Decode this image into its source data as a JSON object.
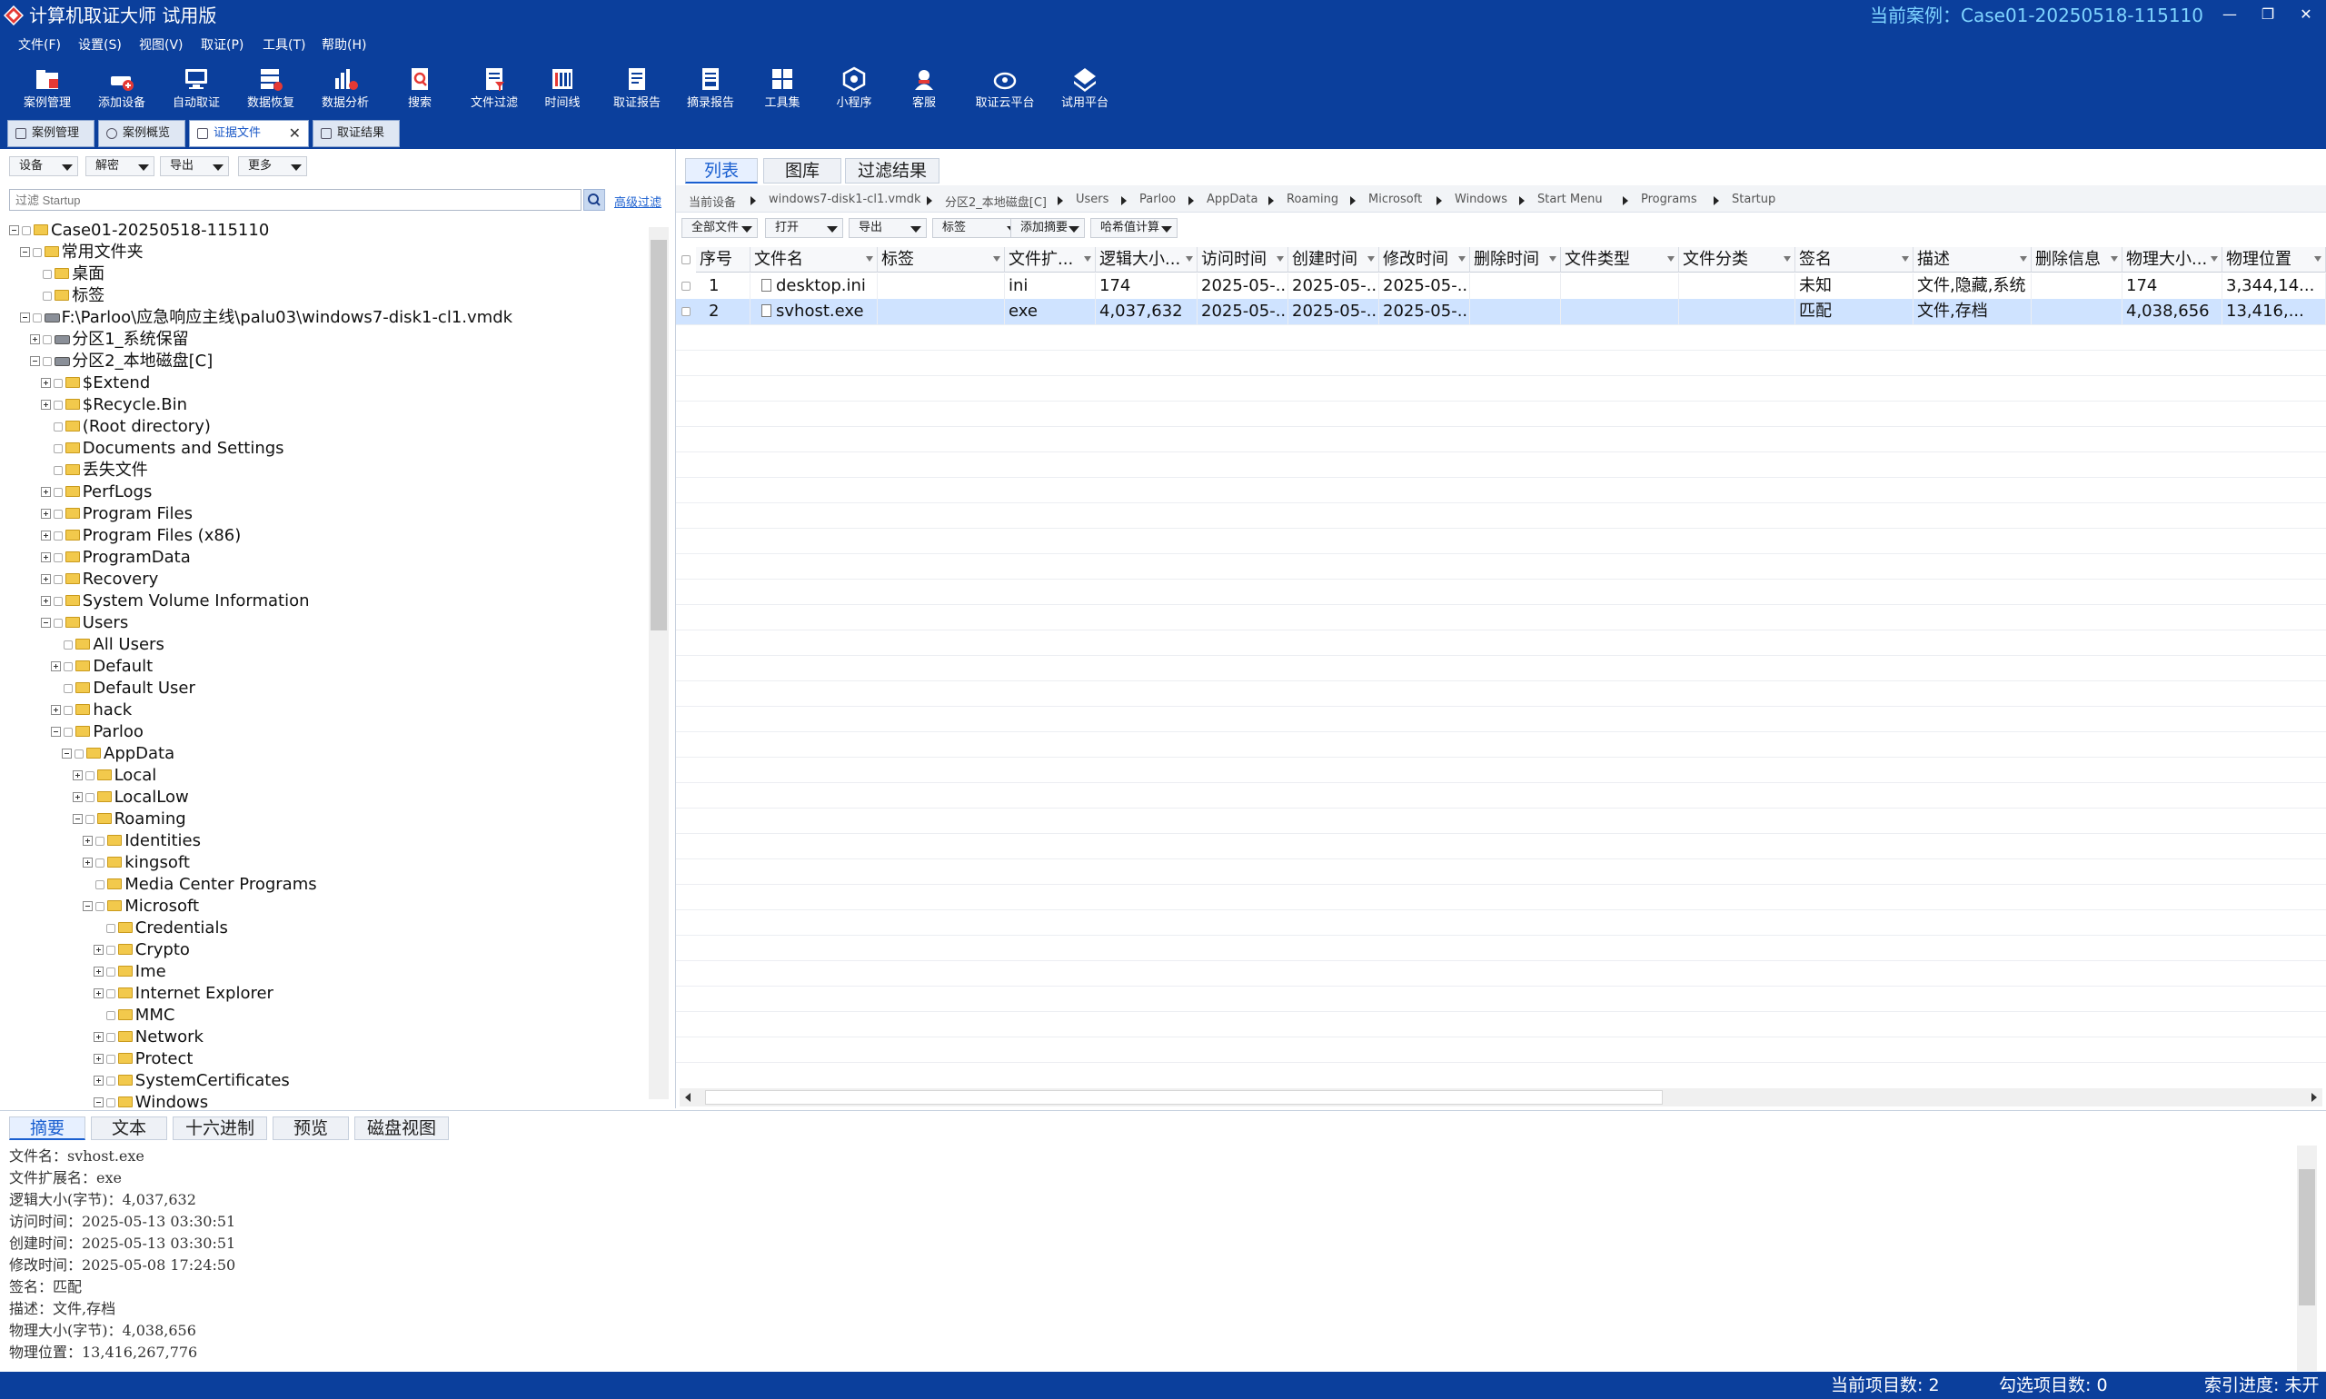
{
  "app": {
    "title": "计算机取证大师 试用版",
    "case_label": "当前案例：Case01-20250518-115110"
  },
  "colors": {
    "chrome": "#0b3f9c",
    "accent": "#1a5fd0",
    "case_text": "#7fd4ff",
    "selection": "#cfe3ff"
  },
  "menu": [
    "文件(F)",
    "设置(S)",
    "视图(V)",
    "取证(P)",
    "工具(T)",
    "帮助(H)"
  ],
  "toolbar": [
    {
      "label": "案例管理",
      "icon": "case-folder-icon"
    },
    {
      "label": "添加设备",
      "icon": "add-device-icon"
    },
    {
      "label": "自动取证",
      "icon": "auto-forensics-icon"
    },
    {
      "label": "数据恢复",
      "icon": "data-recovery-icon"
    },
    {
      "label": "数据分析",
      "icon": "data-analysis-icon"
    },
    {
      "label": "搜索",
      "icon": "search-doc-icon"
    },
    {
      "label": "文件过滤",
      "icon": "file-filter-icon"
    },
    {
      "label": "时间线",
      "icon": "timeline-icon"
    },
    {
      "label": "取证报告",
      "icon": "report-icon"
    },
    {
      "label": "摘录报告",
      "icon": "excerpt-report-icon"
    },
    {
      "label": "工具集",
      "icon": "toolset-icon"
    },
    {
      "label": "小程序",
      "icon": "mini-program-icon"
    },
    {
      "label": "客服",
      "icon": "customer-service-icon"
    },
    {
      "label": "取证云平台",
      "icon": "cloud-platform-icon"
    },
    {
      "label": "试用平台",
      "icon": "trial-platform-icon"
    }
  ],
  "doc_tabs": [
    "案例管理",
    "案例概览",
    "证据文件",
    "取证结果"
  ],
  "left": {
    "dropdowns": [
      "设备",
      "解密",
      "导出",
      "更多"
    ],
    "filter_placeholder": "过滤 Startup",
    "adv_filter": "高级过滤",
    "tree": [
      {
        "label": "Case01-20250518-115110",
        "level": 0,
        "exp": "minus",
        "type": "folder"
      },
      {
        "label": "常用文件夹",
        "level": 1,
        "exp": "minus",
        "type": "folder"
      },
      {
        "label": "桌面",
        "level": 2,
        "exp": "none",
        "type": "folder"
      },
      {
        "label": "标签",
        "level": 2,
        "exp": "none",
        "type": "folder"
      },
      {
        "label": "F:\\Parloo\\应急响应主线\\palu03\\windows7-disk1-cl1.vmdk",
        "level": 1,
        "exp": "minus",
        "type": "disk"
      },
      {
        "label": "分区1_系统保留",
        "level": 2,
        "exp": "plus",
        "type": "disk"
      },
      {
        "label": "分区2_本地磁盘[C]",
        "level": 2,
        "exp": "minus",
        "type": "disk"
      },
      {
        "label": "$Extend",
        "level": 3,
        "exp": "plus",
        "type": "folder"
      },
      {
        "label": "$Recycle.Bin",
        "level": 3,
        "exp": "plus",
        "type": "folder"
      },
      {
        "label": "(Root directory)",
        "level": 3,
        "exp": "none",
        "type": "folder"
      },
      {
        "label": "Documents and Settings",
        "level": 3,
        "exp": "none",
        "type": "folder"
      },
      {
        "label": "丢失文件",
        "level": 3,
        "exp": "none",
        "type": "folder"
      },
      {
        "label": "PerfLogs",
        "level": 3,
        "exp": "plus",
        "type": "folder"
      },
      {
        "label": "Program Files",
        "level": 3,
        "exp": "plus",
        "type": "folder"
      },
      {
        "label": "Program Files (x86)",
        "level": 3,
        "exp": "plus",
        "type": "folder"
      },
      {
        "label": "ProgramData",
        "level": 3,
        "exp": "plus",
        "type": "folder"
      },
      {
        "label": "Recovery",
        "level": 3,
        "exp": "plus",
        "type": "folder"
      },
      {
        "label": "System Volume Information",
        "level": 3,
        "exp": "plus",
        "type": "folder"
      },
      {
        "label": "Users",
        "level": 3,
        "exp": "minus",
        "type": "folder"
      },
      {
        "label": "All Users",
        "level": 4,
        "exp": "none",
        "type": "folder"
      },
      {
        "label": "Default",
        "level": 4,
        "exp": "plus",
        "type": "folder"
      },
      {
        "label": "Default User",
        "level": 4,
        "exp": "none",
        "type": "folder"
      },
      {
        "label": "hack",
        "level": 4,
        "exp": "plus",
        "type": "folder"
      },
      {
        "label": "Parloo",
        "level": 4,
        "exp": "minus",
        "type": "folder"
      },
      {
        "label": "AppData",
        "level": 5,
        "exp": "minus",
        "type": "folder"
      },
      {
        "label": "Local",
        "level": 6,
        "exp": "plus",
        "type": "folder"
      },
      {
        "label": "LocalLow",
        "level": 6,
        "exp": "plus",
        "type": "folder"
      },
      {
        "label": "Roaming",
        "level": 6,
        "exp": "minus",
        "type": "folder"
      },
      {
        "label": "Identities",
        "level": 7,
        "exp": "plus",
        "type": "folder"
      },
      {
        "label": "kingsoft",
        "level": 7,
        "exp": "plus",
        "type": "folder"
      },
      {
        "label": "Media Center Programs",
        "level": 7,
        "exp": "none",
        "type": "folder"
      },
      {
        "label": "Microsoft",
        "level": 7,
        "exp": "minus",
        "type": "folder"
      },
      {
        "label": "Credentials",
        "level": 8,
        "exp": "none",
        "type": "folder"
      },
      {
        "label": "Crypto",
        "level": 8,
        "exp": "plus",
        "type": "folder"
      },
      {
        "label": "Ime",
        "level": 8,
        "exp": "plus",
        "type": "folder"
      },
      {
        "label": "Internet Explorer",
        "level": 8,
        "exp": "plus",
        "type": "folder"
      },
      {
        "label": "MMC",
        "level": 8,
        "exp": "none",
        "type": "folder"
      },
      {
        "label": "Network",
        "level": 8,
        "exp": "plus",
        "type": "folder"
      },
      {
        "label": "Protect",
        "level": 8,
        "exp": "plus",
        "type": "folder"
      },
      {
        "label": "SystemCertificates",
        "level": 8,
        "exp": "plus",
        "type": "folder"
      },
      {
        "label": "Windows",
        "level": 8,
        "exp": "minus",
        "type": "folder"
      }
    ]
  },
  "right": {
    "tabs": [
      "列表",
      "图库",
      "过滤结果"
    ],
    "breadcrumb": [
      "当前设备",
      "windows7-disk1-cl1.vmdk",
      "分区2_本地磁盘[C]",
      "Users",
      "Parloo",
      "AppData",
      "Roaming",
      "Microsoft",
      "Windows",
      "Start Menu",
      "Programs",
      "Startup"
    ],
    "actions": [
      "全部文件",
      "打开",
      "导出",
      "标签",
      "添加摘要",
      "哈希值计算"
    ],
    "columns": [
      "序号",
      "文件名",
      "标签",
      "文件扩...",
      "逻辑大小...",
      "访问时间",
      "创建时间",
      "修改时间",
      "删除时间",
      "文件类型",
      "文件分类",
      "签名",
      "描述",
      "删除信息",
      "物理大小...",
      "物理位置"
    ],
    "rows": [
      [
        "1",
        "desktop.ini",
        "",
        "ini",
        "174",
        "2025-05-...",
        "2025-05-...",
        "2025-05-...",
        "",
        "",
        "",
        "未知",
        "文件,隐藏,系统",
        "",
        "174",
        "3,344,14..."
      ],
      [
        "2",
        "svhost.exe",
        "",
        "exe",
        "4,037,632",
        "2025-05-...",
        "2025-05-...",
        "2025-05-...",
        "",
        "",
        "",
        "匹配",
        "文件,存档",
        "",
        "4,038,656",
        "13,416,..."
      ]
    ],
    "selected_row": 2
  },
  "bottom": {
    "tabs": [
      "摘要",
      "文本",
      "十六进制",
      "预览",
      "磁盘视图"
    ],
    "summary": [
      "文件名：svhost.exe",
      "文件扩展名：exe",
      "逻辑大小(字节)：4,037,632",
      "访问时间：2025-05-13 03:30:51",
      "创建时间：2025-05-13 03:30:51",
      "修改时间：2025-05-08 17:24:50",
      "签名：匹配",
      "描述：文件,存档",
      "物理大小(字节)：4,038,656",
      "物理位置：13,416,267,776"
    ]
  },
  "status": {
    "current_count": "当前项目数: 2",
    "checked_count": "勾选项目数: 0",
    "index_progress": "索引进度: 未开"
  }
}
